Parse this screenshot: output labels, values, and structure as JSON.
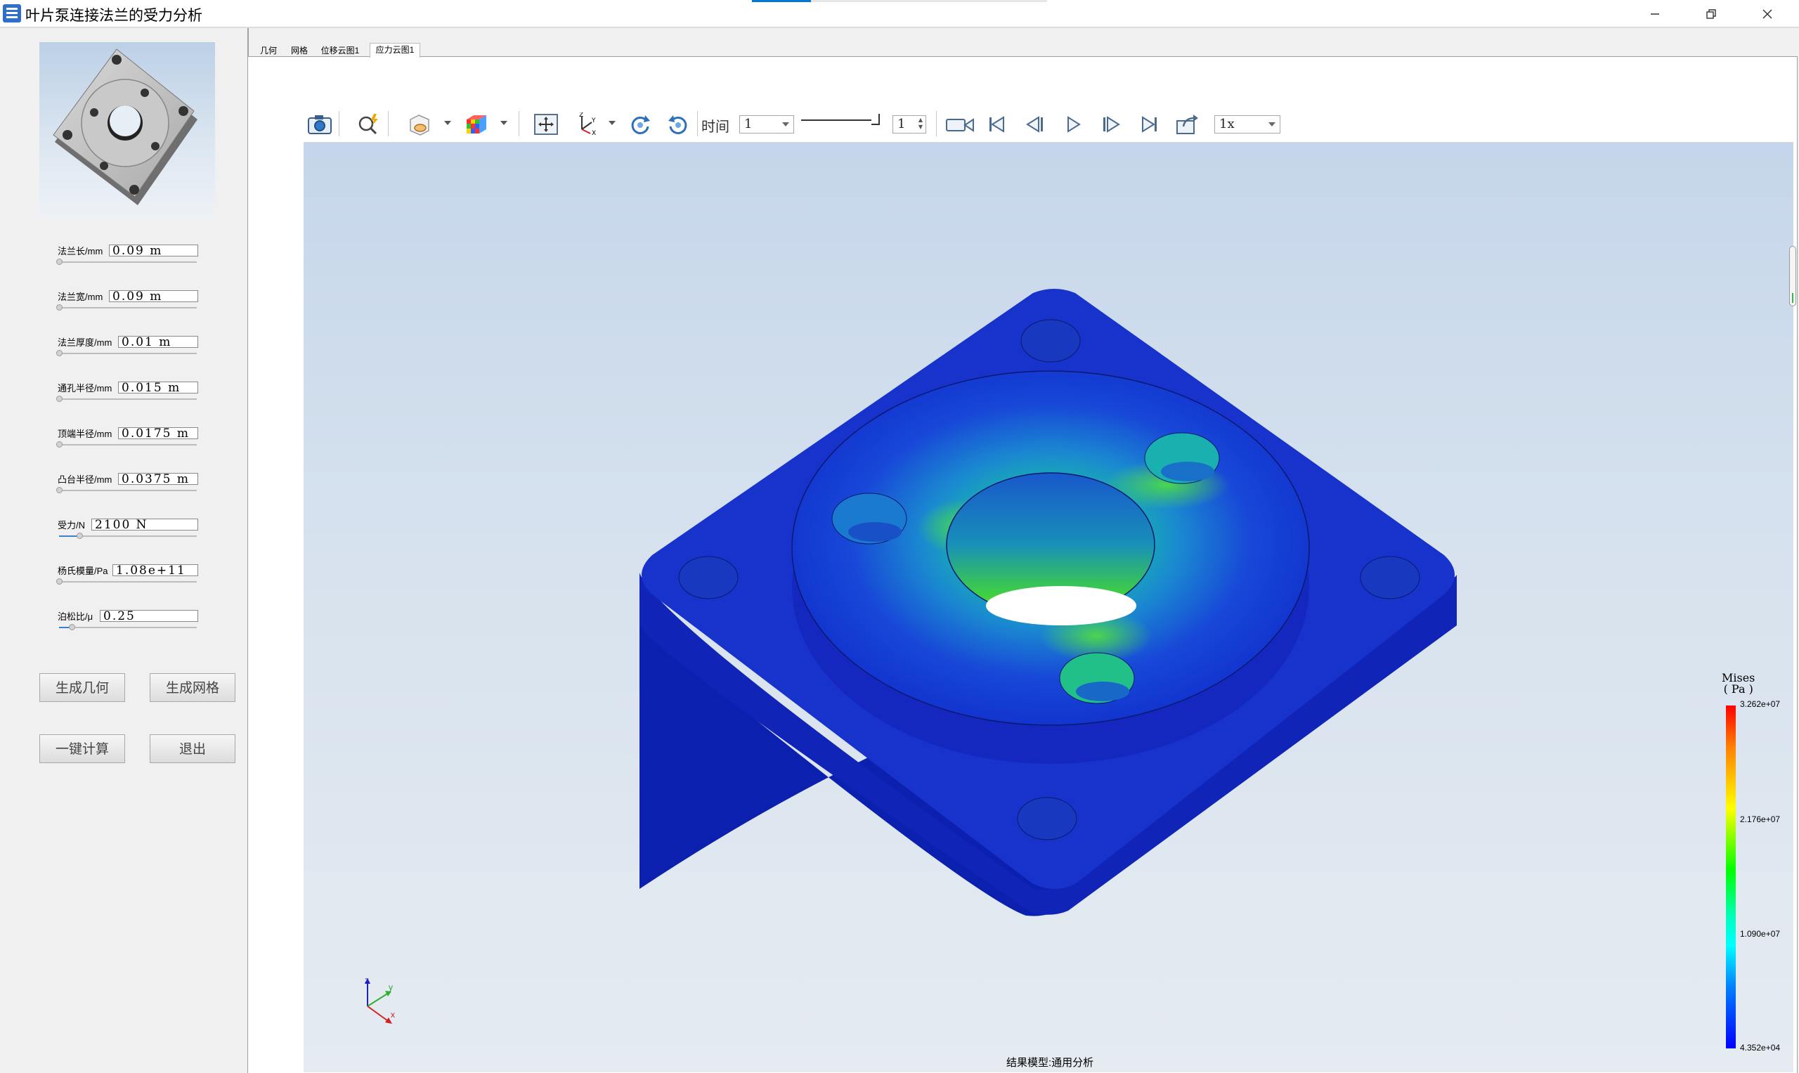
{
  "window": {
    "title": "叶片泵连接法兰的受力分析",
    "minimize_icon": "minimize-icon",
    "maximize_icon": "restore-icon",
    "close_icon": "close-icon"
  },
  "params": [
    {
      "label": "法兰长/mm",
      "value": "0.09 m",
      "slider_fraction": 0.0
    },
    {
      "label": "法兰宽/mm",
      "value": "0.09 m",
      "slider_fraction": 0.0
    },
    {
      "label": "法兰厚度/mm",
      "value": "0.01 m",
      "slider_fraction": 0.0
    },
    {
      "label": "通孔半径/mm",
      "value": "0.015 m",
      "slider_fraction": 0.0
    },
    {
      "label": "顶端半径/mm",
      "value": "0.0175 m",
      "slider_fraction": 0.0
    },
    {
      "label": "凸台半径/mm",
      "value": "0.0375 m",
      "slider_fraction": 0.0
    },
    {
      "label": "受力/N",
      "value": "2100 N",
      "slider_fraction": 0.15
    },
    {
      "label": "杨氏模量/Pa",
      "value": "1.08e+11",
      "slider_fraction": 0.0
    },
    {
      "label": "泊松比/μ",
      "value": "0.25",
      "slider_fraction": 0.09
    }
  ],
  "buttons": {
    "generate_geometry": "生成几何",
    "generate_mesh": "生成网格",
    "compute": "一键计算",
    "exit": "退出"
  },
  "tabs": [
    {
      "label": "几何",
      "active": false
    },
    {
      "label": "网格",
      "active": false
    },
    {
      "label": "位移云图1",
      "active": false
    },
    {
      "label": "应力云图1",
      "active": true
    }
  ],
  "toolbar": {
    "time_label": "时间",
    "time_value": "1",
    "step_value": "1",
    "speed_value": "1x",
    "icons": [
      "camera-icon",
      "zoom-icon",
      "display-mode-icon",
      "color-cube-icon",
      "fit-view-icon",
      "axes-icon",
      "rotate-cw-icon",
      "rotate-ccw-icon",
      "record-video-icon",
      "first-frame-icon",
      "prev-frame-icon",
      "play-icon",
      "next-frame-icon",
      "last-frame-icon",
      "export-icon"
    ]
  },
  "legend": {
    "title_line1": "Mises",
    "title_line2": "( Pa )",
    "max": "3.262e+07",
    "mid_high": "2.176e+07",
    "mid_low": "1.090e+07",
    "min": "4.352e+04",
    "colors": [
      "#ff0000",
      "#ffff00",
      "#00ff00",
      "#00ffff",
      "#0000ff"
    ]
  },
  "viewport": {
    "status": "结果模型:通用分析",
    "background_top": "#c5d6ea",
    "background_bottom": "#e5ebf1"
  },
  "triad": {
    "z": "z",
    "y": "y",
    "x": "x"
  }
}
